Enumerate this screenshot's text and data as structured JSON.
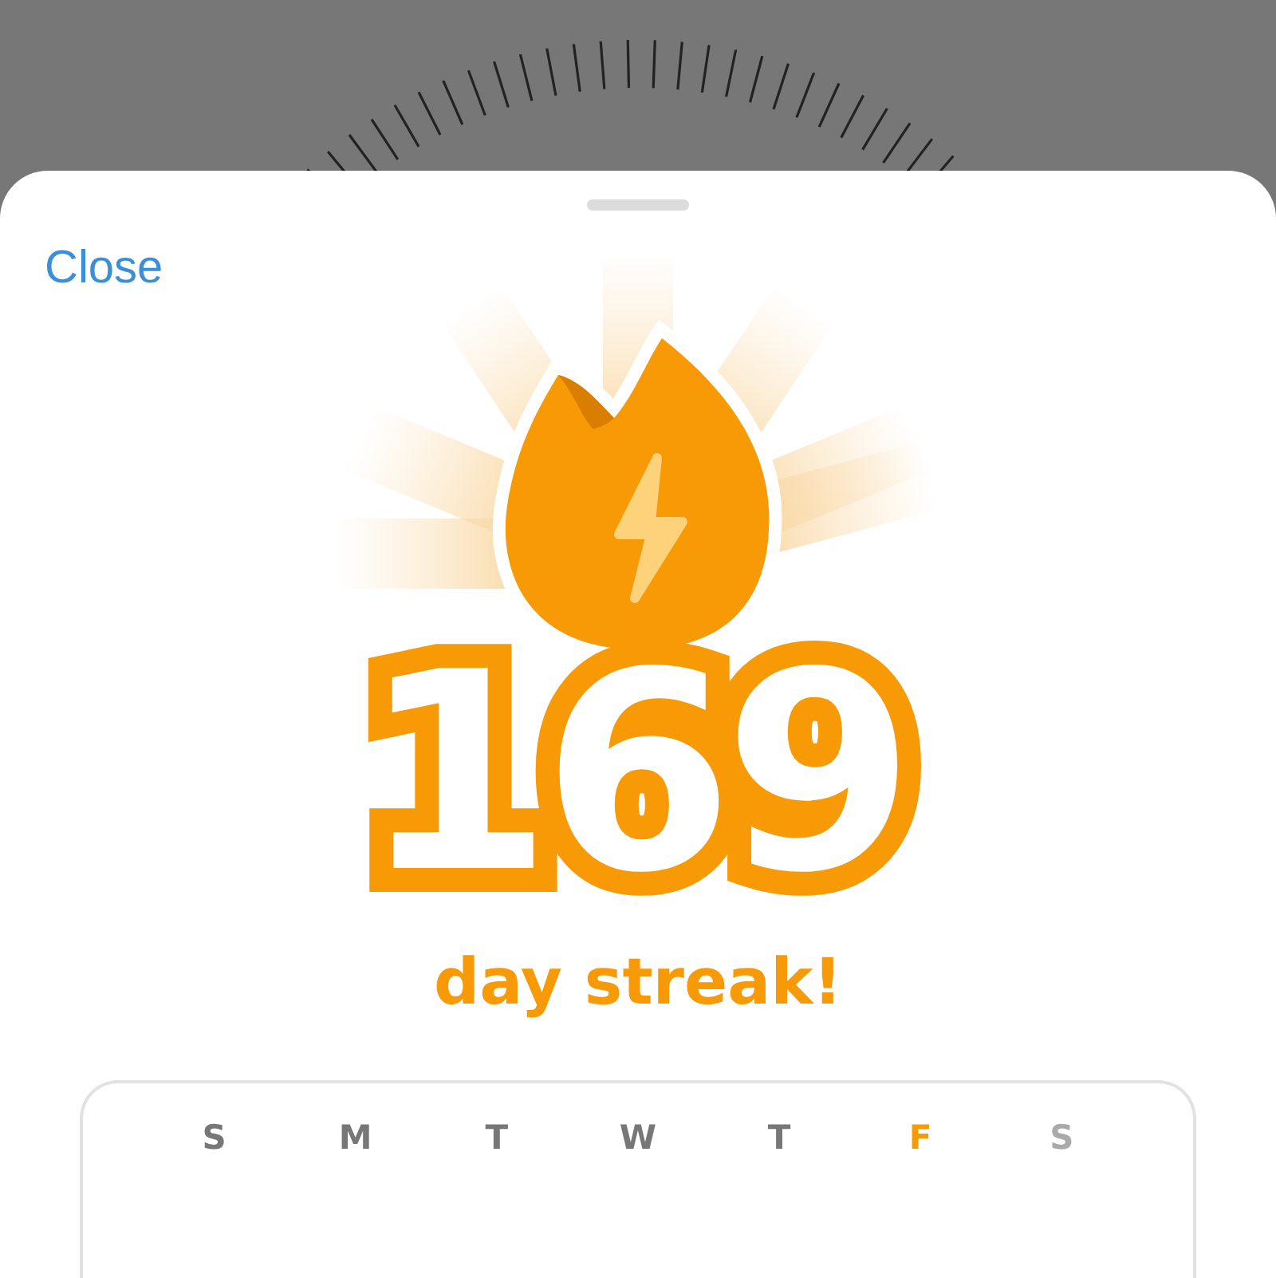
{
  "close_button": "Close",
  "streak": {
    "count": "169",
    "label": "day streak!"
  },
  "week": [
    {
      "letter": "S",
      "kind": "past"
    },
    {
      "letter": "M",
      "kind": "past"
    },
    {
      "letter": "T",
      "kind": "past"
    },
    {
      "letter": "W",
      "kind": "past"
    },
    {
      "letter": "T",
      "kind": "past"
    },
    {
      "letter": "F",
      "kind": "today"
    },
    {
      "letter": "S",
      "kind": "future"
    }
  ]
}
